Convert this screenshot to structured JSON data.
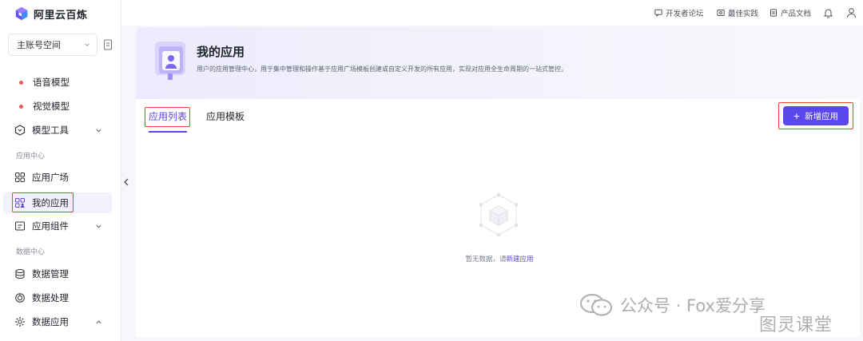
{
  "brand": {
    "name": "阿里云百炼"
  },
  "workspace": {
    "label": "主账号空间"
  },
  "nav": {
    "items_top": [
      {
        "label": "语音模型"
      },
      {
        "label": "视觉模型"
      },
      {
        "label": "模型工具"
      }
    ],
    "section_app": "应用中心",
    "items_app": [
      {
        "label": "应用广场"
      },
      {
        "label": "我的应用"
      },
      {
        "label": "应用组件"
      }
    ],
    "section_data": "数据中心",
    "items_data": [
      {
        "label": "数据管理"
      },
      {
        "label": "数据处理"
      },
      {
        "label": "数据应用"
      }
    ]
  },
  "topbar": {
    "links": [
      {
        "label": "开发者论坛"
      },
      {
        "label": "最佳实践"
      },
      {
        "label": "产品文档"
      }
    ]
  },
  "header": {
    "title": "我的应用",
    "description": "用户的应用管理中心，用于集中管理和操作基于应用广场模板创建或自定义开发的所有应用，实现对应用全生命周期的一站式管控。"
  },
  "tabs": [
    {
      "label": "应用列表",
      "active": true
    },
    {
      "label": "应用模板",
      "active": false
    }
  ],
  "actions": {
    "new_app": "新增应用"
  },
  "empty_state": {
    "text": "暂无数据，请",
    "link": "新建应用"
  },
  "watermark": {
    "line1": "公众号 · Fox爱分享",
    "line2": "图灵课堂"
  },
  "colors": {
    "accent": "#5b48ec",
    "highlight_box": "#e4492f",
    "dot": "#e85a5a"
  }
}
